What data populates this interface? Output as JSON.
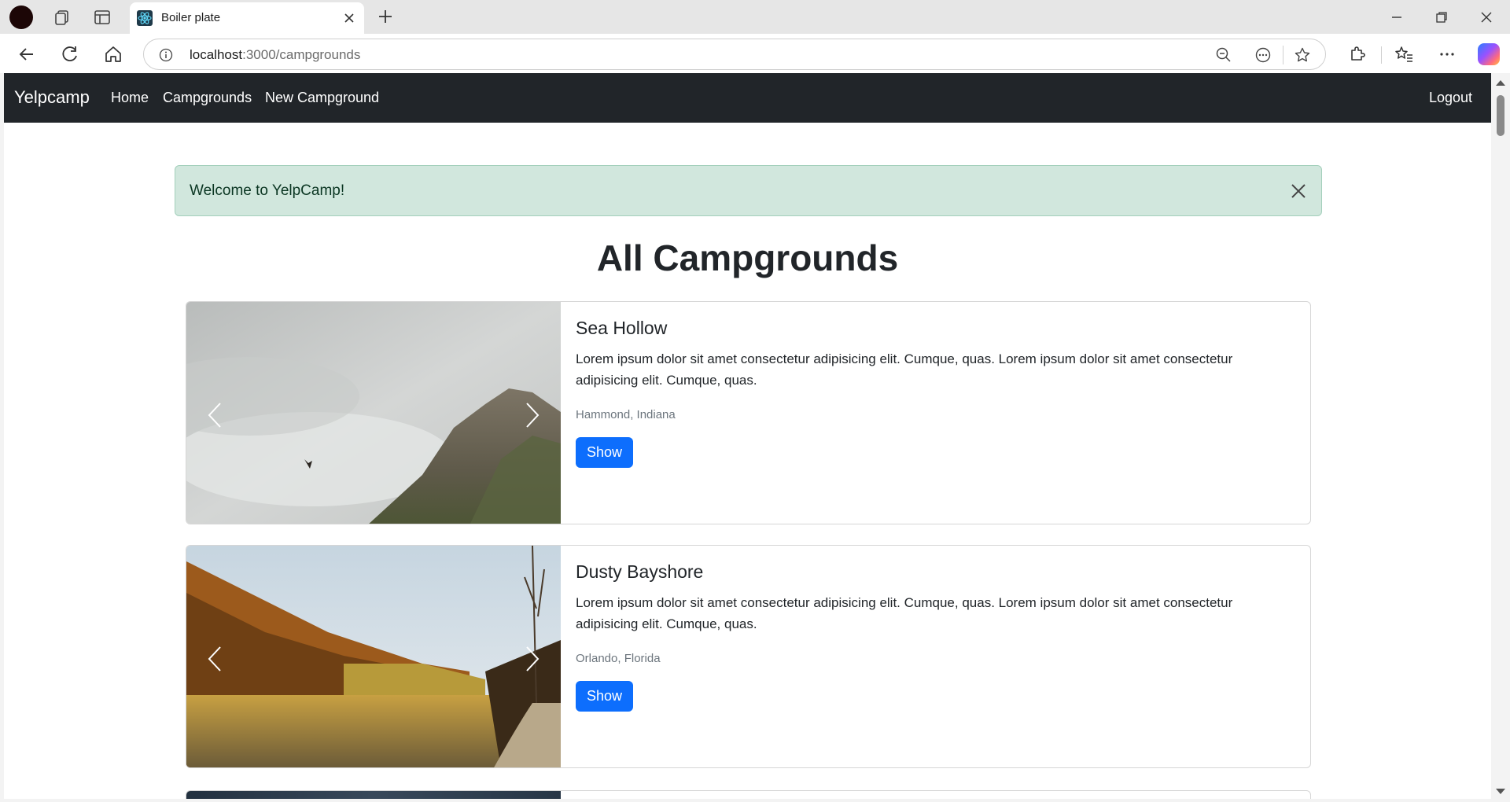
{
  "browser": {
    "tab_title": "Boiler plate",
    "url_host": "localhost",
    "url_path": ":3000/campgrounds"
  },
  "navbar": {
    "brand": "Yelpcamp",
    "links": [
      "Home",
      "Campgrounds",
      "New Campground"
    ],
    "logout": "Logout"
  },
  "alert": {
    "message": "Welcome to YelpCamp!"
  },
  "page": {
    "title": "All Campgrounds"
  },
  "campgrounds": [
    {
      "title": "Sea Hollow",
      "description": "Lorem ipsum dolor sit amet consectetur adipisicing elit. Cumque, quas. Lorem ipsum dolor sit amet consectetur adipisicing elit. Cumque, quas.",
      "location": "Hammond, Indiana",
      "button": "Show"
    },
    {
      "title": "Dusty Bayshore",
      "description": "Lorem ipsum dolor sit amet consectetur adipisicing elit. Cumque, quas. Lorem ipsum dolor sit amet consectetur adipisicing elit. Cumque, quas.",
      "location": "Orlando, Florida",
      "button": "Show"
    }
  ],
  "colors": {
    "navbar": "#212529",
    "alert_bg": "#d1e7dd",
    "primary": "#0d6efd"
  }
}
